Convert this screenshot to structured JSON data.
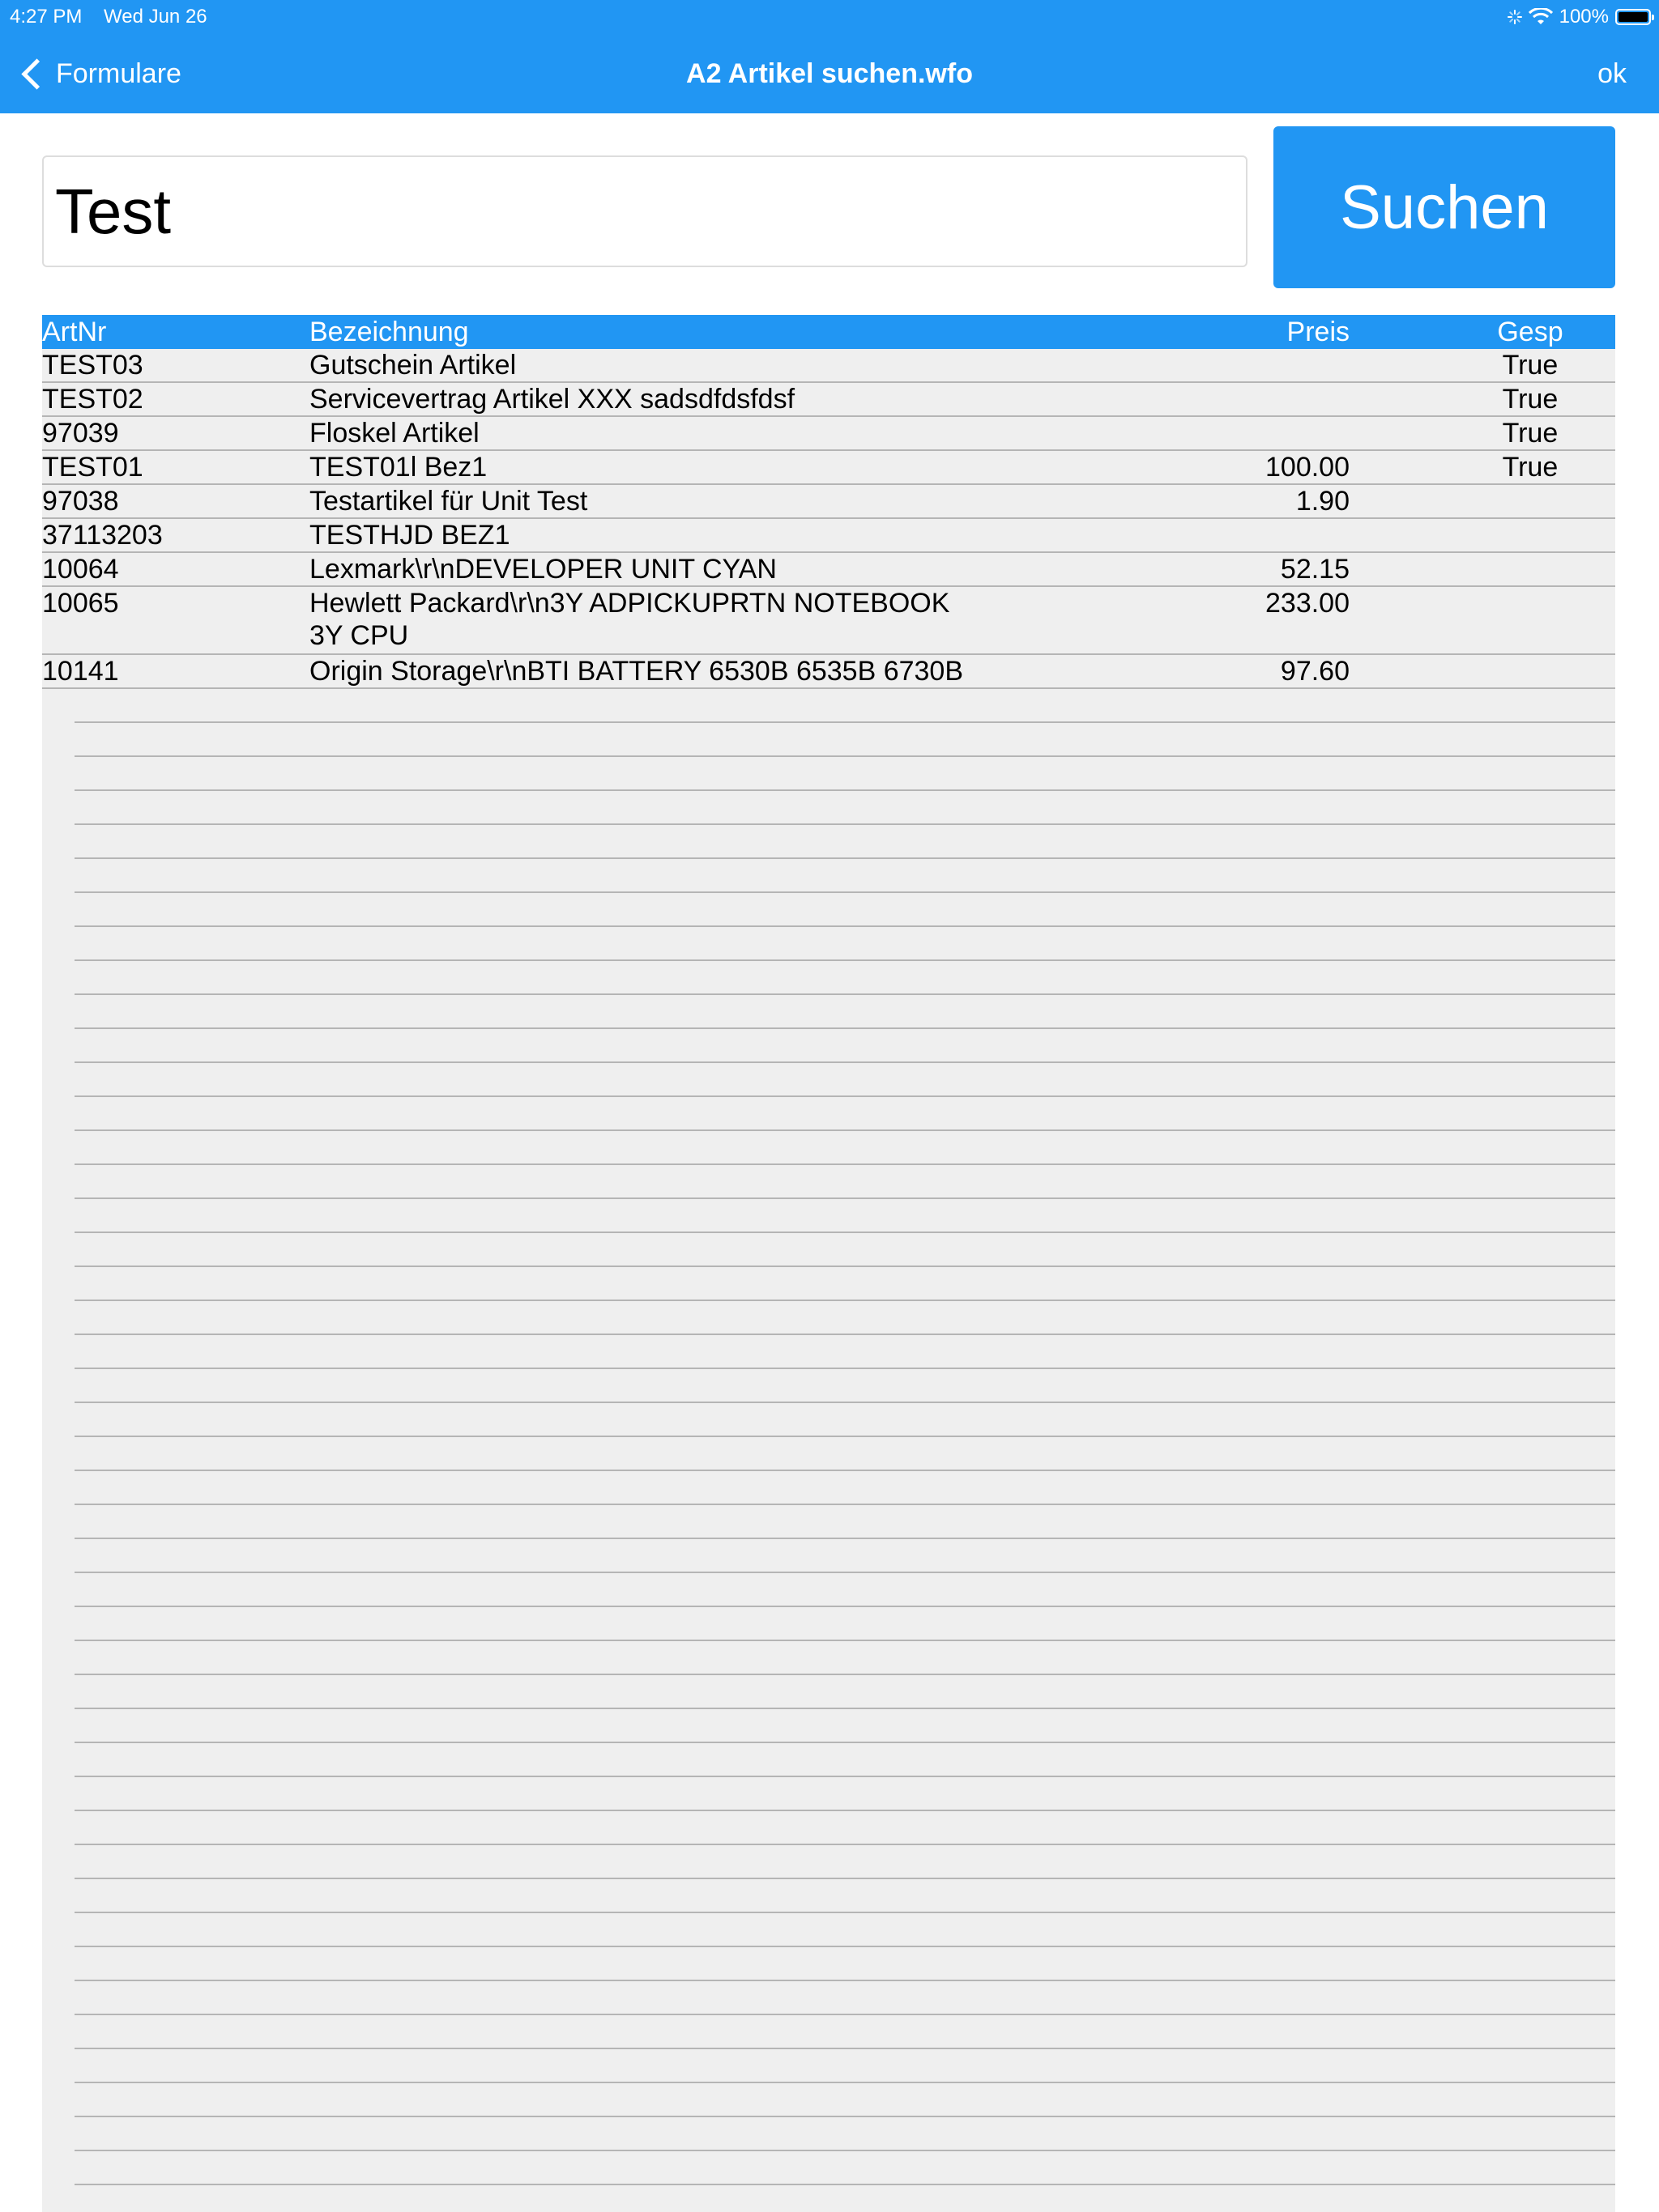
{
  "status_bar": {
    "time": "4:27 PM",
    "date": "Wed Jun 26",
    "battery": "100%"
  },
  "nav": {
    "back_label": "Formulare",
    "title": "A2 Artikel suchen.wfo",
    "ok_label": "ok"
  },
  "search": {
    "value": "Test",
    "button_label": "Suchen"
  },
  "table": {
    "headers": {
      "artnr": "ArtNr",
      "bezeichnung": "Bezeichnung",
      "preis": "Preis",
      "gesp": "Gesp"
    },
    "rows": [
      {
        "artnr": "TEST03",
        "bezeichnung": "Gutschein Artikel",
        "preis": "",
        "gesp": "True"
      },
      {
        "artnr": "TEST02",
        "bezeichnung": "Servicevertrag Artikel XXX sadsdfdsfdsf",
        "preis": "",
        "gesp": "True"
      },
      {
        "artnr": "97039",
        "bezeichnung": "Floskel Artikel",
        "preis": "",
        "gesp": "True"
      },
      {
        "artnr": "TEST01",
        "bezeichnung": "TEST01l Bez1",
        "preis": "100.00",
        "gesp": "True"
      },
      {
        "artnr": "97038",
        "bezeichnung": "Testartikel für Unit Test",
        "preis": "1.90",
        "gesp": ""
      },
      {
        "artnr": "37113203",
        "bezeichnung": "TESTHJD BEZ1",
        "preis": "",
        "gesp": ""
      },
      {
        "artnr": "10064",
        "bezeichnung": "Lexmark\\r\\nDEVELOPER UNIT CYAN",
        "preis": "52.15",
        "gesp": ""
      },
      {
        "artnr": "10065",
        "bezeichnung": "Hewlett Packard\\r\\n3Y ADPICKUPRTN NOTEBOOK\n3Y CPU",
        "preis": "233.00",
        "gesp": ""
      },
      {
        "artnr": "10141",
        "bezeichnung": "Origin Storage\\r\\nBTI BATTERY 6530B 6535B 6730B",
        "preis": "97.60",
        "gesp": ""
      }
    ]
  }
}
